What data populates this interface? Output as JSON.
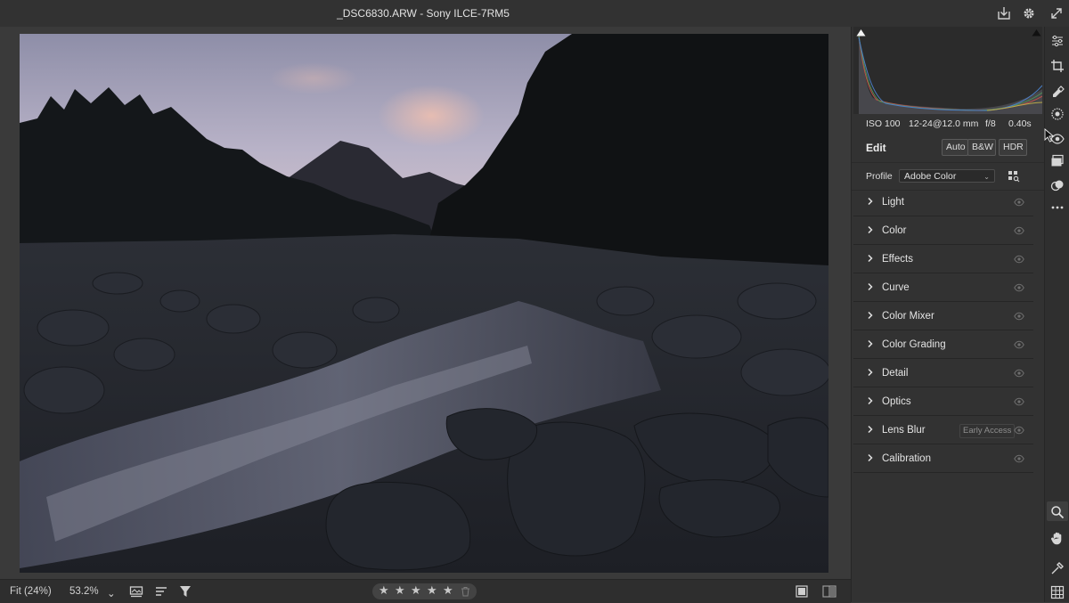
{
  "window": {
    "title": "_DSC6830.ARW  -  Sony ILCE-7RM5"
  },
  "titlebar_icons": [
    "export-icon",
    "gear-icon",
    "expand-icon"
  ],
  "bottombar": {
    "fit_label": "Fit (24%)",
    "zoom_value": "53.2%",
    "zoom_caret": "⌄",
    "icons": [
      "filmstrip-icon",
      "sort-icon",
      "filter-icon"
    ],
    "rating": {
      "stars": 5,
      "filled": 0,
      "glyph": "★",
      "reject_icon": "trash-icon"
    },
    "right_icons": [
      "before-after-icon",
      "compare-view-icon"
    ]
  },
  "histogram": {
    "shadow_clip_icon": "shadow-clip-icon",
    "highlight_clip_icon": "highlight-clip-icon"
  },
  "exif": {
    "iso": "ISO 100",
    "lens": "12-24@12.0 mm",
    "aperture": "f/8",
    "shutter": "0.40s"
  },
  "edit": {
    "title": "Edit",
    "buttons": [
      "Auto",
      "B&W",
      "HDR"
    ],
    "profile_label": "Profile",
    "profile_value": "Adobe Color",
    "profile_caret": "⌄"
  },
  "sections": [
    {
      "label": "Light"
    },
    {
      "label": "Color"
    },
    {
      "label": "Effects"
    },
    {
      "label": "Curve"
    },
    {
      "label": "Color Mixer"
    },
    {
      "label": "Color Grading"
    },
    {
      "label": "Detail"
    },
    {
      "label": "Optics"
    },
    {
      "label": "Lens Blur",
      "badge": "Early Access"
    },
    {
      "label": "Calibration"
    }
  ],
  "tools_top": [
    "edit-sliders-icon",
    "crop-icon",
    "healing-icon",
    "masking-icon",
    "red-eye-icon",
    "presets-icon",
    "snapshots-icon",
    "more-icon"
  ],
  "tools_bottom": [
    "zoom-icon",
    "hand-icon",
    "sampler-icon",
    "grid-icon"
  ],
  "colors": {
    "panel": "#323232",
    "canvas": "#3a3a3a",
    "text": "#e4e4e4"
  }
}
